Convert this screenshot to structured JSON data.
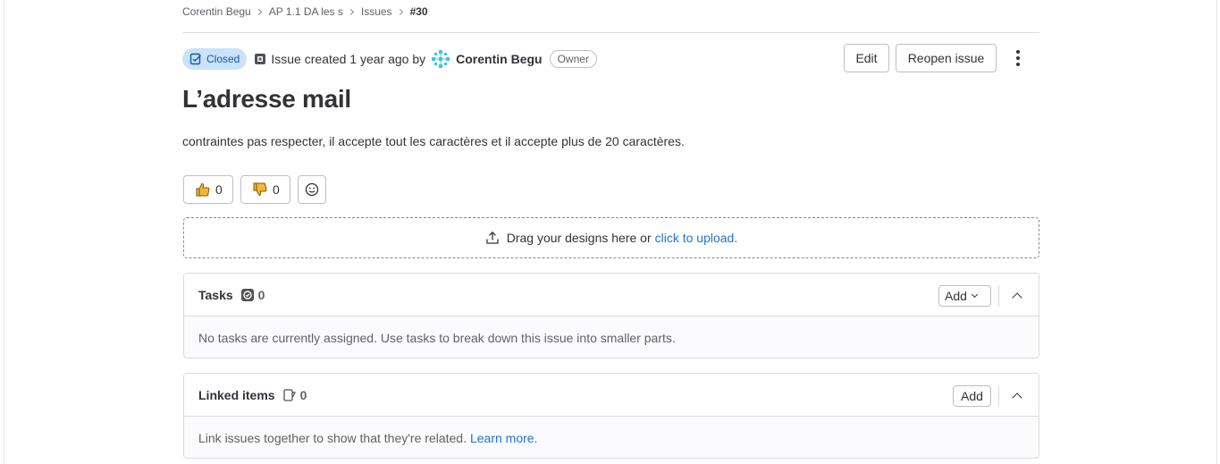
{
  "breadcrumb": [
    "Corentin Begu",
    "AP 1.1 DA les s",
    "Issues",
    "#30"
  ],
  "issue": {
    "status": "Closed",
    "created_text": "Issue created 1 year ago by",
    "author": "Corentin Begu",
    "author_role": "Owner",
    "title": "L’adresse mail",
    "description": "contraintes pas respecter, il accepte tout les caractères et il accepte plus de 20 caractères."
  },
  "actions": {
    "edit": "Edit",
    "reopen": "Reopen issue"
  },
  "reactions": {
    "thumbs_up": "0",
    "thumbs_down": "0"
  },
  "upload": {
    "text": "Drag your designs here or",
    "link": "click to upload."
  },
  "tasks": {
    "title": "Tasks",
    "count": "0",
    "add": "Add",
    "empty": "No tasks are currently assigned. Use tasks to break down this issue into smaller parts."
  },
  "linked": {
    "title": "Linked items",
    "count": "0",
    "add": "Add",
    "empty": "Link issues together to show that they're related.",
    "learn_more": "Learn more."
  },
  "colors": {
    "closed_badge_bg": "#cbe2f9",
    "closed_badge_text": "#0b5cad",
    "link": "#1f75cb"
  }
}
